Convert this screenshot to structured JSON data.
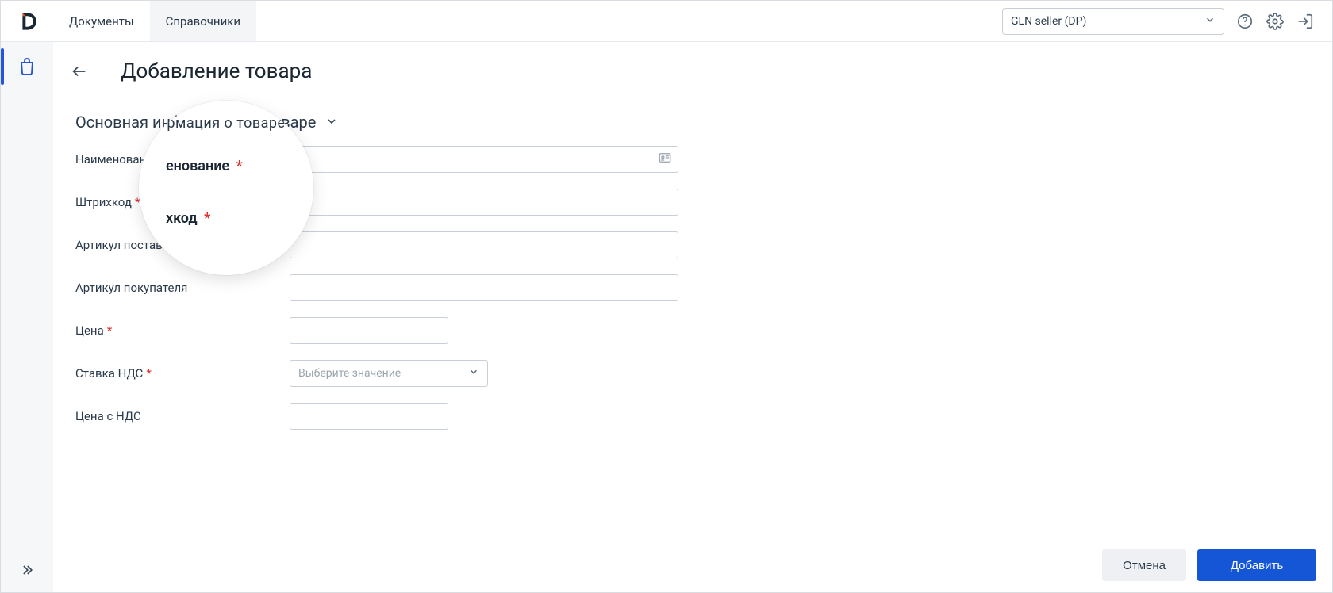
{
  "header": {
    "nav": {
      "documents": "Документы",
      "directories": "Справочники"
    },
    "role_selector_label": "GLN seller (DP)"
  },
  "page": {
    "title": "Добавление товара",
    "section_title": "Основная информация о товаре"
  },
  "form": {
    "name": {
      "label": "Наименование",
      "required": true,
      "value": ""
    },
    "barcode": {
      "label": "Штрихкод",
      "required": true,
      "value": ""
    },
    "article_sup": {
      "label": "Артикул поставщика",
      "required": false,
      "value": ""
    },
    "article_buy": {
      "label": "Артикул покупателя",
      "required": false,
      "value": ""
    },
    "price": {
      "label": "Цена",
      "required": true,
      "value": ""
    },
    "vat_rate": {
      "label": "Ставка НДС",
      "required": true,
      "placeholder": "Выберите значение",
      "value": ""
    },
    "price_vat": {
      "label": "Цена с НДС",
      "required": false,
      "value": ""
    }
  },
  "buttons": {
    "cancel": "Отмена",
    "submit": "Добавить"
  },
  "lens": {
    "frag_top": "рмация о товаре",
    "zoom_name_label": "енование",
    "zoom_barcode_label": "хкод"
  }
}
